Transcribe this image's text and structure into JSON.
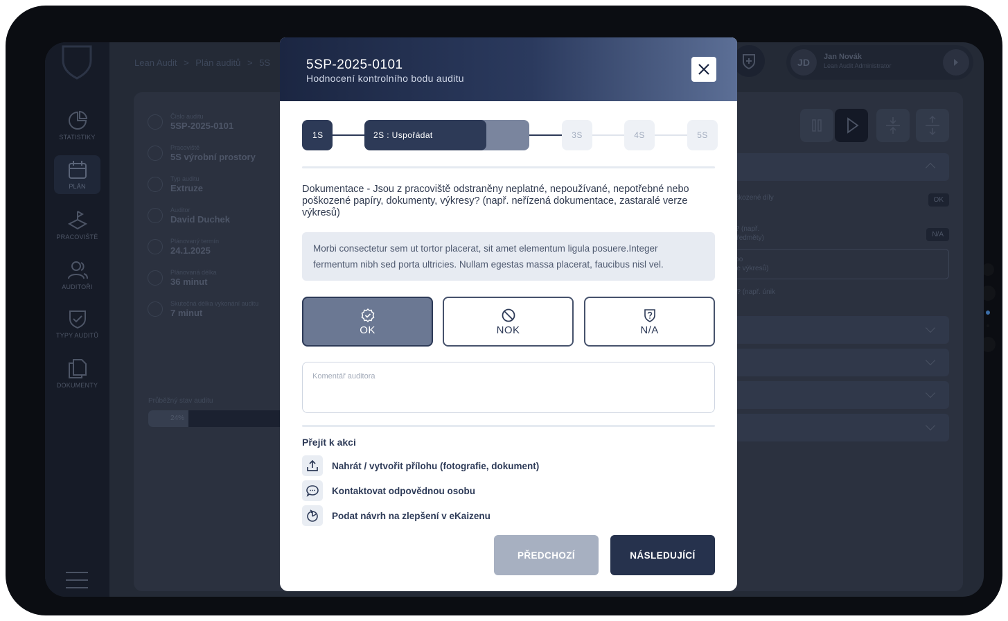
{
  "app": {
    "nav": [
      {
        "label": "STATISTIKY",
        "icon": "pie-chart-icon"
      },
      {
        "label": "PLÁN",
        "icon": "calendar-icon"
      },
      {
        "label": "PRACOVIŠTĚ",
        "icon": "workplace-flag-icon"
      },
      {
        "label": "AUDITOŘI",
        "icon": "auditors-icon"
      },
      {
        "label": "TYPY AUDITŮ",
        "icon": "shield-check-icon"
      },
      {
        "label": "DOKUMENTY",
        "icon": "documents-icon"
      }
    ],
    "active_nav": "PLÁN",
    "breadcrumb": [
      "Lean Audit",
      ">",
      "Plán auditů",
      ">",
      "5S"
    ],
    "user": {
      "initials": "JD",
      "name": "Jan Novák",
      "role": "Lean Audit Administrator"
    }
  },
  "audit_info": {
    "rows": [
      {
        "label": "Číslo auditu",
        "value": "5SP-2025-0101"
      },
      {
        "label": "Pracoviště",
        "value": "5S výrobní prostory"
      },
      {
        "label": "Typ auditu",
        "value": "Extruze"
      },
      {
        "label": "Auditor",
        "value": "David Duchek"
      },
      {
        "label": "Plánovaný termín",
        "value": "24.1.2025"
      },
      {
        "label": "Plánovaná délka",
        "value": "36 minut"
      },
      {
        "label": "Skutečná délka vykonání auditu",
        "value": "7 minut"
      }
    ],
    "progress_label": "Průběžný stav auditu",
    "progress_text": "24%",
    "progress_value": 0.24
  },
  "background_right": {
    "items": [
      {
        "text": "nebo poškozené díly",
        "badge": "OK"
      },
      {
        "text": "zné věci? (např.\nosobní předměty)",
        "badge": "N/A"
      },
      {
        "text": "ebné nebo\nralé verze výkresů)",
        "badge": ""
      },
      {
        "text": "nergiemi? (např. únik",
        "badge": ""
      }
    ]
  },
  "modal": {
    "title": "5SP-2025-0101",
    "subtitle": "Hodnocení kontrolního bodu auditu",
    "close_icon": "close-icon",
    "steps": [
      {
        "label": "1S",
        "state": "done"
      },
      {
        "label": "2S : Uspořádat",
        "state": "current",
        "progress": 0.74
      },
      {
        "label": "3S",
        "state": "future"
      },
      {
        "label": "4S",
        "state": "future"
      },
      {
        "label": "5S",
        "state": "future"
      }
    ],
    "question": "Dokumentace - Jsou z pracoviště odstraněny neplatné, nepoužívané, nepotřebné nebo poškozené papíry, dokumenty, výkresy? (např. neřízená dokumentace, zastaralé verze výkresů)",
    "answer": "Morbi consectetur sem ut tortor placerat, sit amet elementum ligula posuere.Integer fermentum nibh sed porta ultricies. Nullam egestas massa placerat, faucibus nisl vel.",
    "options": [
      {
        "label": "OK",
        "icon": "check-circle-icon",
        "selected": true
      },
      {
        "label": "NOK",
        "icon": "ban-icon",
        "selected": false
      },
      {
        "label": "N/A",
        "icon": "shield-question-icon",
        "selected": false
      }
    ],
    "comment_placeholder": "Komentář auditora",
    "comment_value": "",
    "actions_title": "Přejít k akci",
    "actions": [
      {
        "label": "Nahrát / vytvořit přílohu (fotografie, dokument)",
        "icon": "upload-icon"
      },
      {
        "label": "Kontaktovat odpovědnou osobu",
        "icon": "chat-bubble-icon"
      },
      {
        "label": "Podat návrh na zlepšení v eKaizenu",
        "icon": "kaizen-icon"
      }
    ],
    "prev_label": "PŘEDCHOZÍ",
    "next_label": "NÁSLEDUJÍCÍ"
  },
  "colors": {
    "primary": "#26324d",
    "selected_option": "#6b7893",
    "disabled_button": "#a7b0c1",
    "header_gradient_start": "#1b2642",
    "header_gradient_end": "#5c6f96"
  }
}
